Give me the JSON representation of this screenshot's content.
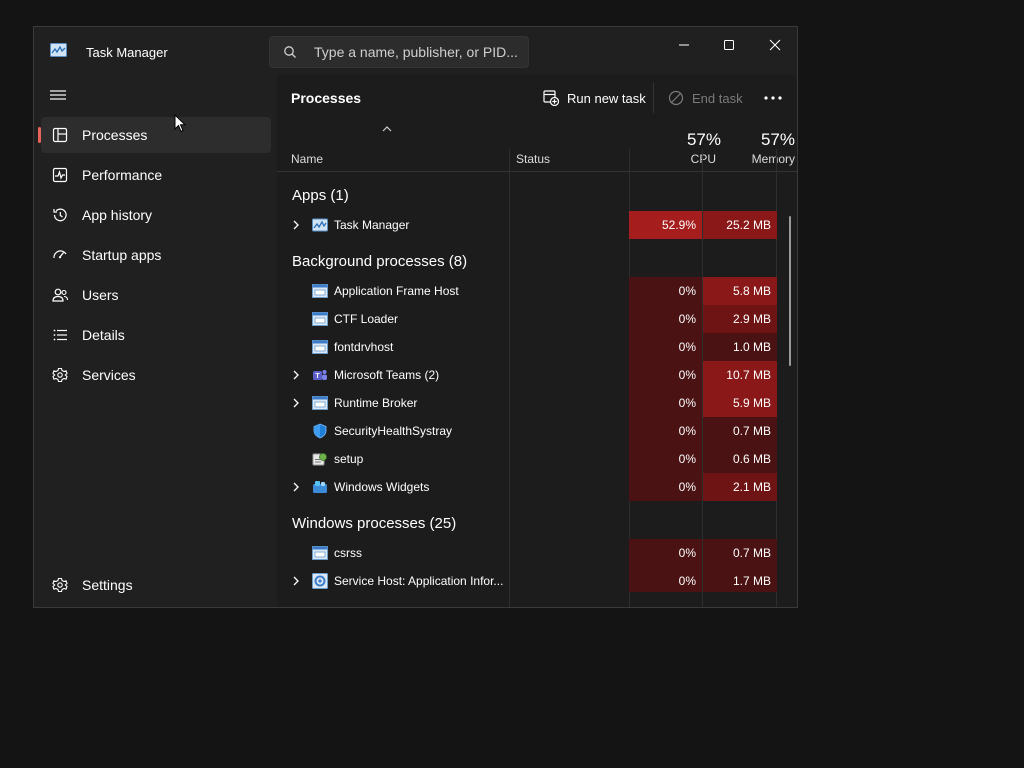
{
  "window": {
    "title": "Task Manager",
    "controls": {
      "minimize": "minimize",
      "maximize": "maximize",
      "close": "close"
    }
  },
  "search": {
    "placeholder": "Type a name, publisher, or PID..."
  },
  "sidebar": {
    "items": [
      {
        "label": "Processes",
        "icon": "processes-icon",
        "active": true
      },
      {
        "label": "Performance",
        "icon": "performance-icon"
      },
      {
        "label": "App history",
        "icon": "app-history-icon"
      },
      {
        "label": "Startup apps",
        "icon": "startup-apps-icon"
      },
      {
        "label": "Users",
        "icon": "users-icon"
      },
      {
        "label": "Details",
        "icon": "details-icon"
      },
      {
        "label": "Services",
        "icon": "services-icon"
      }
    ],
    "settings_label": "Settings"
  },
  "main": {
    "title": "Processes",
    "run_new_task": "Run new task",
    "end_task": "End task",
    "columns": {
      "name": "Name",
      "status": "Status",
      "cpu_pct": "57%",
      "cpu": "CPU",
      "mem_pct": "57%",
      "mem": "Memory"
    },
    "groups": {
      "apps": "Apps (1)",
      "background": "Background processes (8)",
      "windows": "Windows processes (25)"
    },
    "processes": [
      {
        "name": "Task Manager",
        "cpu": "52.9%",
        "mem": "25.2 MB",
        "expandable": true,
        "icon": "task-manager-icon"
      },
      {
        "name": "Application Frame Host",
        "cpu": "0%",
        "mem": "5.8 MB",
        "expandable": false,
        "icon": "window-app-icon"
      },
      {
        "name": "CTF Loader",
        "cpu": "0%",
        "mem": "2.9 MB",
        "expandable": false,
        "icon": "window-app-icon"
      },
      {
        "name": "fontdrvhost",
        "cpu": "0%",
        "mem": "1.0 MB",
        "expandable": false,
        "icon": "window-app-icon"
      },
      {
        "name": "Microsoft Teams (2)",
        "cpu": "0%",
        "mem": "10.7 MB",
        "expandable": true,
        "icon": "teams-icon"
      },
      {
        "name": "Runtime Broker",
        "cpu": "0%",
        "mem": "5.9 MB",
        "expandable": true,
        "icon": "window-app-icon"
      },
      {
        "name": "SecurityHealthSystray",
        "cpu": "0%",
        "mem": "0.7 MB",
        "expandable": false,
        "icon": "shield-icon"
      },
      {
        "name": "setup",
        "cpu": "0%",
        "mem": "0.6 MB",
        "expandable": false,
        "icon": "setup-icon"
      },
      {
        "name": "Windows Widgets",
        "cpu": "0%",
        "mem": "2.1 MB",
        "expandable": true,
        "icon": "widgets-icon"
      },
      {
        "name": "csrss",
        "cpu": "0%",
        "mem": "0.7 MB",
        "expandable": false,
        "icon": "window-app-icon"
      },
      {
        "name": "Service Host: Application Infor...",
        "cpu": "0%",
        "mem": "1.7 MB",
        "expandable": true,
        "icon": "service-host-icon"
      }
    ]
  },
  "colors": {
    "accent": "#e8645a",
    "heat_high": "#a51d1d",
    "heat_mid": "#6e1414",
    "heat_low": "#4a1212"
  }
}
